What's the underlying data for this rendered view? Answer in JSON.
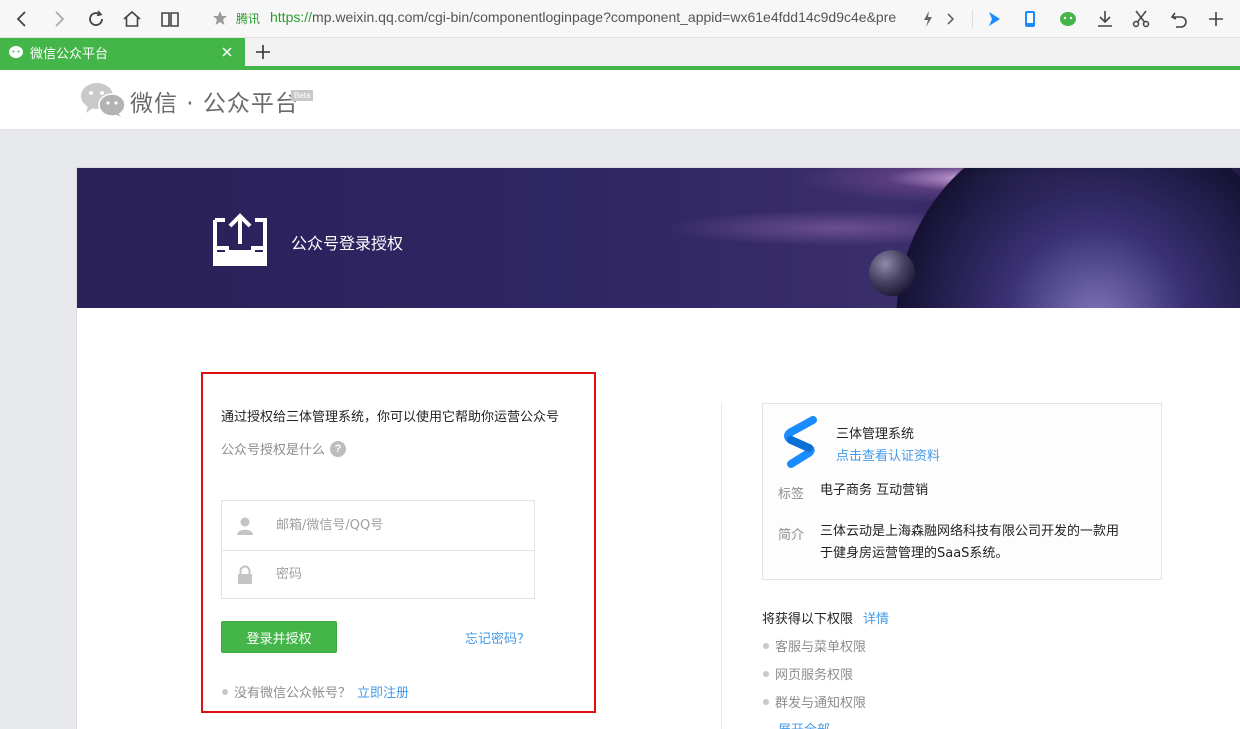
{
  "browser": {
    "url_secure_label": "腾讯",
    "url_scheme": "https://",
    "url_rest": "mp.weixin.qq.com/cgi-bin/componentloginpage?component_appid=wx61e4fdd14c9d9c4e&pre",
    "tab_title": "微信公众平台",
    "new_tab_label": "+"
  },
  "header": {
    "logo_text": "微信 · 公众平台",
    "beta_label": "Beta"
  },
  "banner": {
    "title": "公众号登录授权"
  },
  "login": {
    "intro": "通过授权给三体管理系统，你可以使用它帮助你运营公众号",
    "what_is_auth": "公众号授权是什么",
    "help_icon_text": "?",
    "account_placeholder": "邮箱/微信号/QQ号",
    "password_placeholder": "密码",
    "submit_label": "登录并授权",
    "forgot_label": "忘记密码？",
    "no_account_text": "没有微信公众帐号？",
    "register_label": "立即注册"
  },
  "app": {
    "name": "三体管理系统",
    "cert_link": "点击查看认证资料",
    "tag_label": "标签",
    "tags": "电子商务 互动营销",
    "desc_label": "简介",
    "desc_line1": "三体云动是上海森融网络科技有限公司开发的一款用",
    "desc_line2": "于健身房运营管理的SaaS系统。"
  },
  "permissions": {
    "title": "将获得以下权限",
    "detail_link": "详情",
    "items": [
      "客服与菜单权限",
      "网页服务权限",
      "群发与通知权限"
    ],
    "expand_label": "展开全部"
  },
  "colors": {
    "brand_green": "#44b549",
    "link_blue": "#459ae9",
    "highlight_red": "#e01010"
  }
}
